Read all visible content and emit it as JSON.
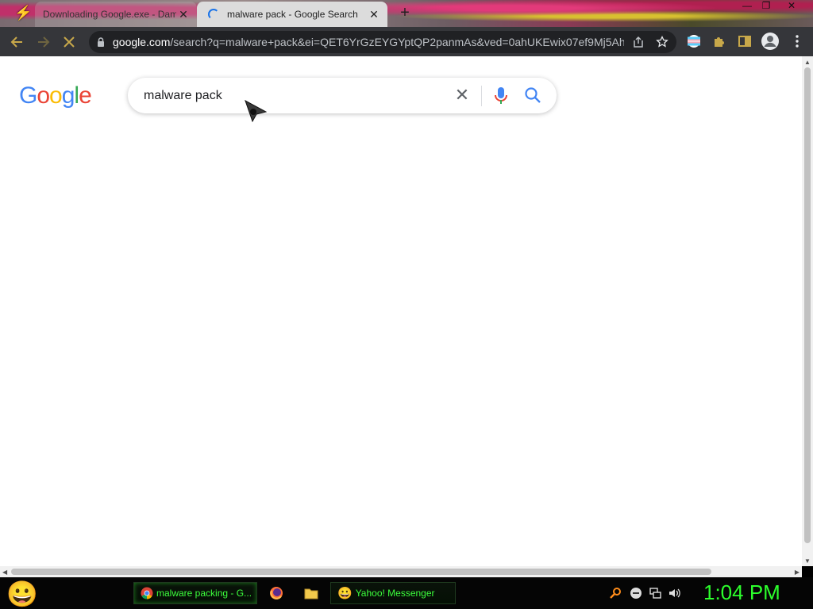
{
  "browser": {
    "tabs": [
      {
        "label": "Downloading Google.exe - Dam",
        "active": false
      },
      {
        "label": "malware pack - Google Search",
        "active": true
      }
    ],
    "new_tab_symbol": "+",
    "close_symbol": "✕",
    "url_host": "google.com",
    "url_path": "/search?q=malware+pack&ei=QET6YrGzEYGYptQP2panmAs&ved=0ahUKEwix07ef9Mj5Ah..."
  },
  "page": {
    "logo_letters": [
      {
        "char": "G",
        "color": "#4285F4"
      },
      {
        "char": "o",
        "color": "#EA4335"
      },
      {
        "char": "o",
        "color": "#FBBC05"
      },
      {
        "char": "g",
        "color": "#4285F4"
      },
      {
        "char": "l",
        "color": "#34A853"
      },
      {
        "char": "e",
        "color": "#EA4335"
      }
    ],
    "search_value": "malware pack",
    "clear_symbol": "✕"
  },
  "taskbar": {
    "tasks": [
      {
        "label": "malware packing - G...",
        "icon": "chrome-icon"
      },
      {
        "label": "Yahoo! Messenger",
        "icon": "yahoo-smiley-icon"
      }
    ],
    "clock": "1:04 PM"
  },
  "colors": {
    "accent_green": "#2cff2c",
    "toolbar_bg": "#35363a",
    "google_blue": "#4285F4"
  }
}
